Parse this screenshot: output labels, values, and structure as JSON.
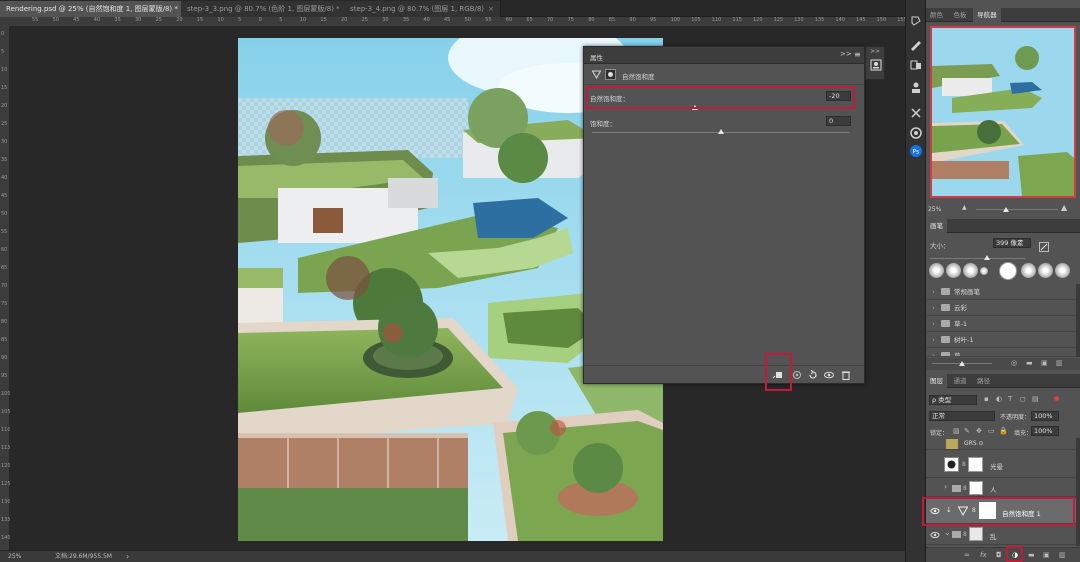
{
  "tabs": [
    {
      "label": "Rendering.psd @ 25% (自然饱和度 1, 图层蒙版/8) *",
      "active": true
    },
    {
      "label": "step-3_3.png @ 80.7% (色阶 1, 图层蒙版/8) *",
      "active": false
    },
    {
      "label": "step-3_4.png @ 80.7% (图层 1, RGB/8)",
      "active": false
    }
  ],
  "tab_close": "×",
  "ruler_h": [
    "55",
    "50",
    "45",
    "40",
    "35",
    "30",
    "25",
    "20",
    "15",
    "10",
    "5",
    "0",
    "5",
    "10",
    "15",
    "20",
    "25",
    "30",
    "35",
    "40",
    "45",
    "50",
    "55",
    "60",
    "65",
    "70",
    "75",
    "80",
    "85",
    "90",
    "95",
    "100",
    "105",
    "110",
    "115",
    "120",
    "125",
    "130",
    "135",
    "140",
    "145",
    "150",
    "155"
  ],
  "ruler_v": [
    "0",
    "5",
    "10",
    "15",
    "20",
    "25",
    "30",
    "35",
    "40",
    "45",
    "50",
    "55",
    "60",
    "65",
    "70",
    "75",
    "80",
    "85",
    "90",
    "95",
    "100",
    "105",
    "110",
    "115",
    "120",
    "125",
    "130",
    "135",
    "140"
  ],
  "status": {
    "zoom": "25%",
    "doc": "文档:29.6M/955.5M",
    "arrow": "›"
  },
  "properties": {
    "title": "属性",
    "adjustment_name": "自然饱和度",
    "vibrance_label": "自然饱和度：",
    "vibrance_value": "-20",
    "vibrance_level": -20,
    "saturation_label": "饱和度：",
    "saturation_value": "0",
    "saturation_level": 0,
    "collapse_glyph": ">>",
    "menu_glyph": "≡"
  },
  "right_tabs_top": [
    {
      "label": "颜色",
      "active": false
    },
    {
      "label": "色板",
      "active": false
    },
    {
      "label": "导航器",
      "active": true
    }
  ],
  "navigator": {
    "zoom": "25%"
  },
  "brushes": {
    "tab": "画笔",
    "size_label": "大小：",
    "size_value": "399 像素",
    "folders": [
      "常规画笔",
      "云彩",
      "草-1",
      "树叶-1",
      "草"
    ]
  },
  "layers_panel": {
    "tabs": [
      {
        "label": "图层",
        "active": true
      },
      {
        "label": "通道",
        "active": false
      },
      {
        "label": "路径",
        "active": false
      }
    ],
    "filter_kind": "ρ 类型",
    "blend_mode": "正常",
    "opacity_label": "不透明度：",
    "opacity_value": "100%",
    "lock_label": "锁定：",
    "fill_label": "填充：",
    "fill_value": "100%",
    "layers": [
      {
        "name": "GRS ⊙",
        "kind": "image"
      },
      {
        "name": "光晕",
        "kind": "masked"
      },
      {
        "name": "人",
        "kind": "group"
      },
      {
        "name": "自然饱和度 1",
        "kind": "adjustment",
        "selected": true
      },
      {
        "name": "乱",
        "kind": "group"
      }
    ],
    "footer_icons": [
      "link-icon",
      "fx-icon",
      "mask-icon",
      "adjustment-icon",
      "folder-icon",
      "new-layer-icon",
      "trash-icon"
    ]
  },
  "colors": {
    "highlight": "#c21a3a",
    "accent_blue": "#1473e6"
  }
}
